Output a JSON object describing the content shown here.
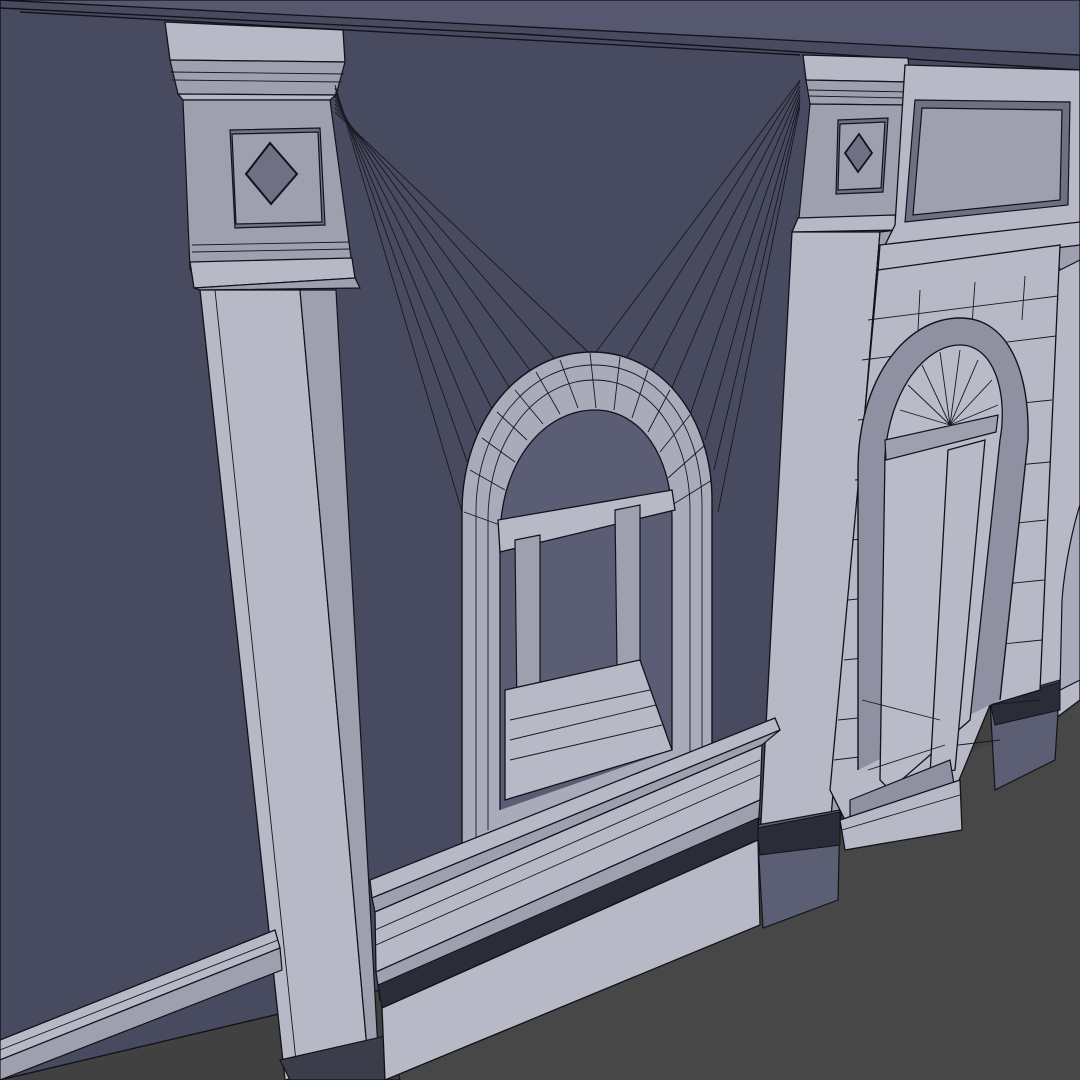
{
  "scene": {
    "background_color": "#414141",
    "wall_color": "#484b5f",
    "trim_light_color": "#b7b9c7",
    "trim_mid_color": "#9ea0b0",
    "trim_dark_color": "#6e7083",
    "edge_color": "#111319"
  }
}
